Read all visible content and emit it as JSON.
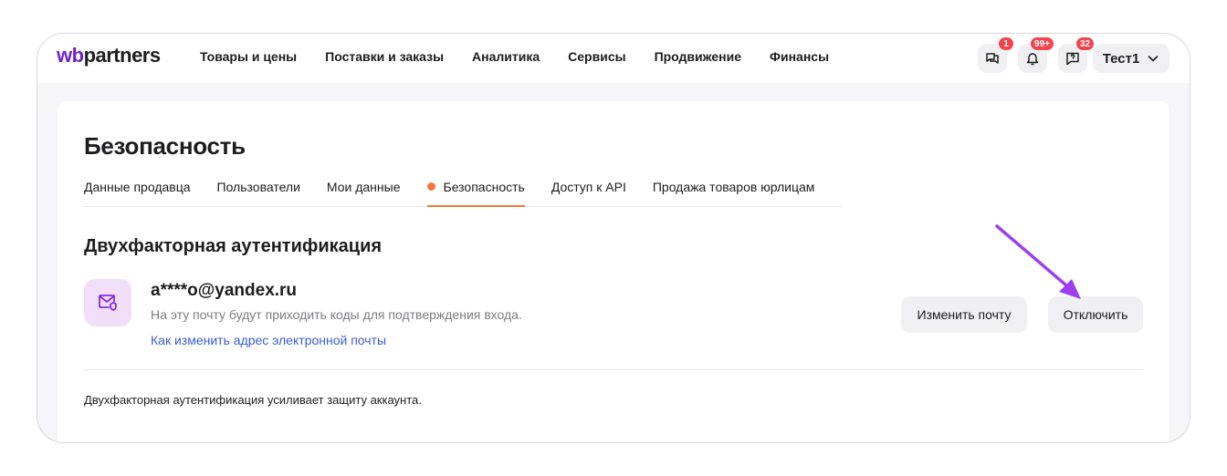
{
  "header": {
    "logo_wb": "wb",
    "logo_partners": "partners",
    "nav": [
      {
        "label": "Товары и цены"
      },
      {
        "label": "Поставки и заказы"
      },
      {
        "label": "Аналитика"
      },
      {
        "label": "Сервисы"
      },
      {
        "label": "Продвижение"
      },
      {
        "label": "Финансы"
      }
    ],
    "icons": [
      {
        "name": "chat-icon",
        "badge": "1"
      },
      {
        "name": "bell-icon",
        "badge": "99+"
      },
      {
        "name": "support-icon",
        "badge": "32"
      }
    ],
    "user": {
      "label": "Тест1",
      "icon": "chevron-down-icon"
    }
  },
  "page": {
    "title": "Безопасность",
    "tabs": [
      {
        "label": "Данные продавца",
        "active": false
      },
      {
        "label": "Пользователи",
        "active": false
      },
      {
        "label": "Мои данные",
        "active": false
      },
      {
        "label": "Безопасность",
        "active": true
      },
      {
        "label": "Доступ к API",
        "active": false
      },
      {
        "label": "Продажа товаров юрлицам",
        "active": false
      }
    ]
  },
  "two_factor": {
    "title": "Двухфакторная аутентификация",
    "icon": "mail-shield-icon",
    "email": "a****o@yandex.ru",
    "description": "На эту почту будут приходить коды для подтверждения входа.",
    "link": "Как изменить адрес электронной почты",
    "change_button": "Изменить почту",
    "disable_button": "Отключить",
    "footnote": "Двухфакторная аутентификация усиливает защиту аккаунта."
  },
  "colors": {
    "brand": "#6e1fd6",
    "accent": "#f07a3d",
    "badge": "#f2444f",
    "link": "#3a5bd8",
    "annotation_arrow": "#9b3ff0"
  }
}
